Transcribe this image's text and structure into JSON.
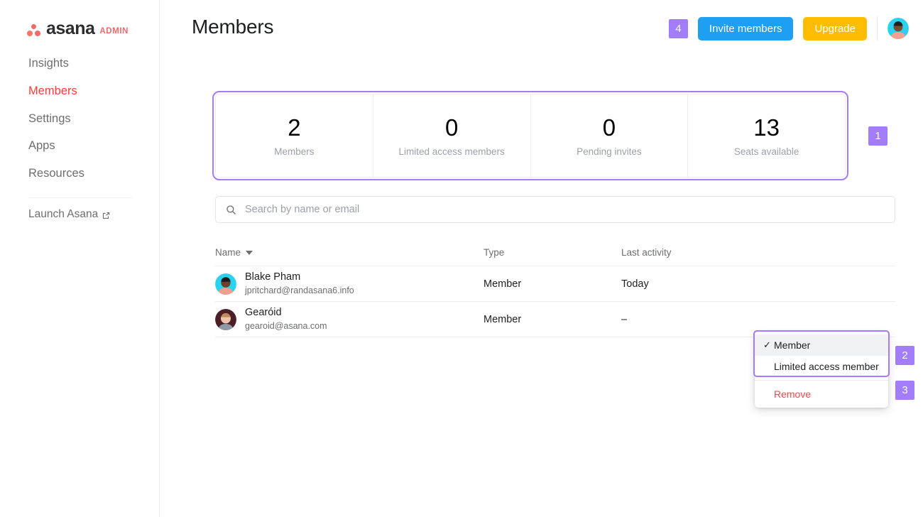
{
  "brand": {
    "name": "asana",
    "suffix": "ADMIN",
    "logo_icon": "asana-logo-icon",
    "accent_color": "#f06a6a"
  },
  "sidebar": {
    "items": [
      {
        "label": "Insights",
        "active": false
      },
      {
        "label": "Members",
        "active": true
      },
      {
        "label": "Settings",
        "active": false
      },
      {
        "label": "Apps",
        "active": false
      },
      {
        "label": "Resources",
        "active": false
      }
    ],
    "launch": {
      "label": "Launch Asana",
      "icon": "external-link-icon"
    },
    "active_color": "#fb3c3c"
  },
  "header": {
    "title": "Members",
    "badge": "4",
    "invite_label": "Invite members",
    "upgrade_label": "Upgrade",
    "invite_color": "#1e9ff2",
    "upgrade_color": "#fcbd01",
    "avatar_icon": "user-avatar",
    "badge_color": "#a37cfa"
  },
  "stats": {
    "badge": "1",
    "cards": [
      {
        "value": "2",
        "label": "Members"
      },
      {
        "value": "0",
        "label": "Limited access members"
      },
      {
        "value": "0",
        "label": "Pending invites"
      },
      {
        "value": "13",
        "label": "Seats available"
      }
    ]
  },
  "search": {
    "placeholder": "Search by name or email",
    "value": "",
    "icon": "search-icon"
  },
  "table": {
    "columns": [
      "Name",
      "Type",
      "Last activity"
    ],
    "sort_column": "Name",
    "sort_icon": "sort-descending-caret-icon",
    "rows": [
      {
        "name": "Blake Pham",
        "email": "jpritchard@randasana6.info",
        "type": "Member",
        "last_activity": "Today",
        "avatar_bg": "#2ad2f0",
        "avatar_skin": "#5a3a2a",
        "avatar_shirt": "#f0a89a"
      },
      {
        "name": "Gearóid",
        "email": "gearoid@asana.com",
        "type": "Member",
        "last_activity": "–",
        "avatar_bg": "#4a1f28",
        "avatar_skin": "#f2c4ab",
        "avatar_shirt": "#9aa6b2"
      }
    ]
  },
  "menu": {
    "badge_group": "2",
    "badge_remove": "3",
    "items": [
      {
        "label": "Member",
        "selected": true,
        "check": "✓"
      },
      {
        "label": "Limited access member",
        "selected": false,
        "check": ""
      }
    ],
    "remove_label": "Remove",
    "remove_color": "#f8444c",
    "highlight_color": "#a37cfa"
  }
}
